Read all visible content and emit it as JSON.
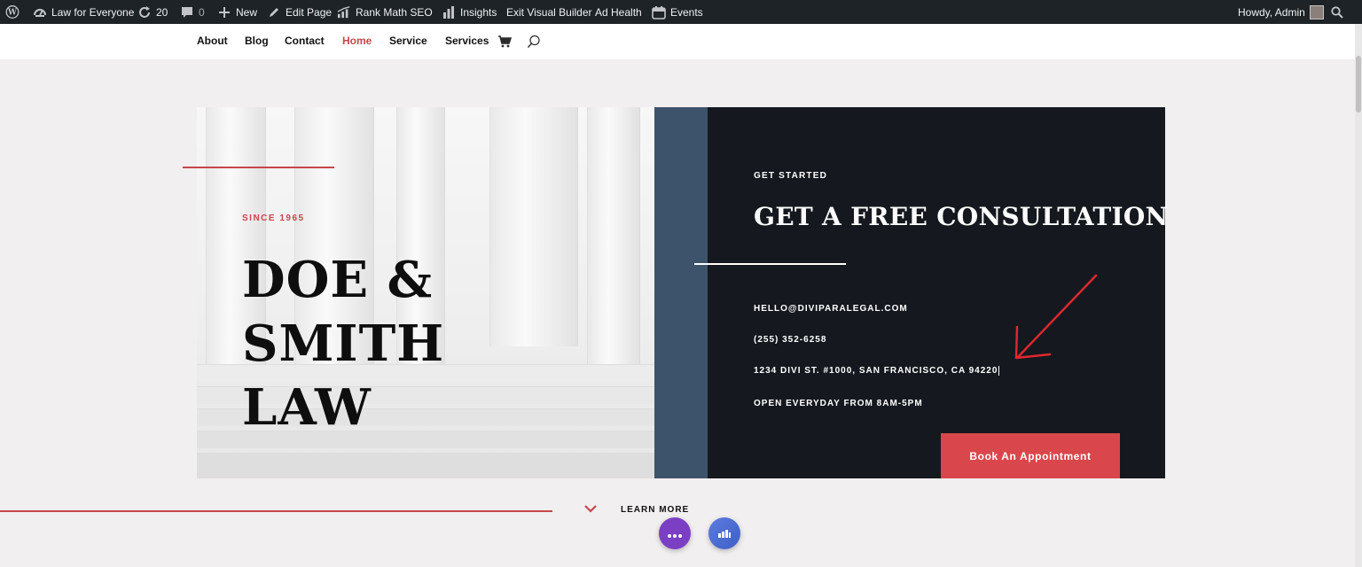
{
  "admin_bar": {
    "site_name": "Law for Everyone",
    "updates_count": "20",
    "comments_count": "0",
    "new_label": "New",
    "edit_page_label": "Edit Page",
    "rank_math_label": "Rank Math SEO",
    "insights_label": "Insights",
    "exit_builder_label": "Exit Visual Builder",
    "ad_health_label": "Ad Health",
    "events_label": "Events",
    "howdy_label": "Howdy, Admin"
  },
  "nav": {
    "items": [
      {
        "label": "About",
        "active": false
      },
      {
        "label": "Blog",
        "active": false
      },
      {
        "label": "Contact",
        "active": false
      },
      {
        "label": "Home",
        "active": true
      },
      {
        "label": "Service",
        "active": false
      },
      {
        "label": "Services",
        "active": false
      }
    ]
  },
  "hero": {
    "since": "SINCE 1965",
    "title_line1": "DOE & SMITH",
    "title_line2": "LAW"
  },
  "consultation": {
    "eyebrow": "GET STARTED",
    "title": "GET A FREE CONSULTATION",
    "email": "HELLO@DIVIPARALEGAL.COM",
    "phone": "(255) 352-6258",
    "address": "1234 DIVI ST. #1000, SAN FRANCISCO, CA 94220",
    "hours": "OPEN EVERYDAY FROM 8AM-5PM",
    "button_label": "Book An Appointment"
  },
  "footer_cta": {
    "learn_more": "LEARN MORE"
  },
  "colors": {
    "accent_red": "#c6474a",
    "button_red": "#d9464b",
    "dark_panel": "#15191f",
    "slate_blue": "#3d536b",
    "admin_bar": "#1d2327",
    "page_bg": "#f2eff0"
  },
  "icons": [
    "wordpress-icon",
    "dashboard-icon",
    "updates-icon",
    "comment-icon",
    "plus-icon",
    "pencil-icon",
    "rank-math-icon",
    "bar-chart-icon",
    "events-icon",
    "search-icon",
    "cart-icon",
    "chevron-down-icon",
    "dots-icon",
    "layers-icon"
  ]
}
